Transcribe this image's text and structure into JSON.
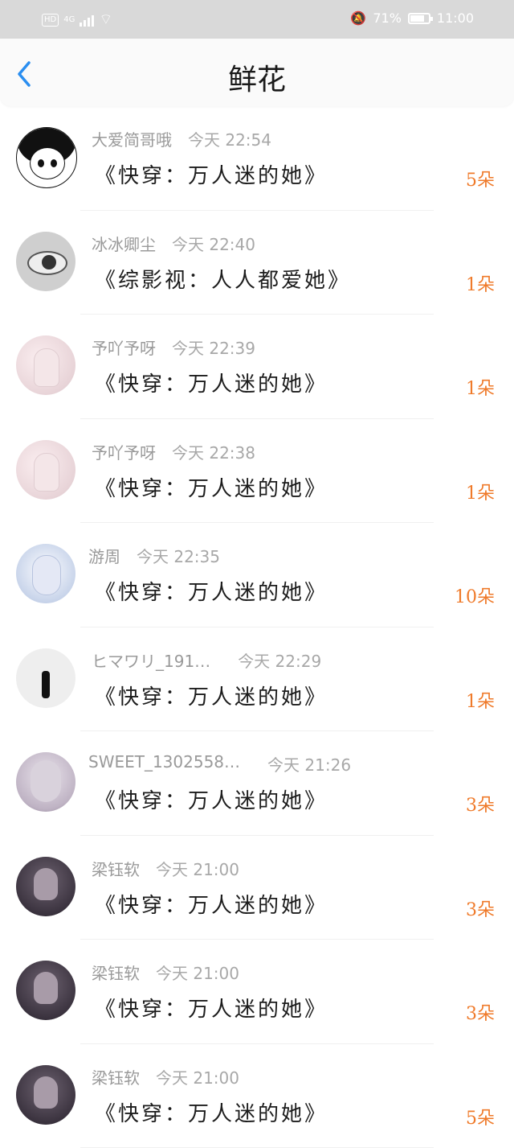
{
  "status_bar": {
    "network": "4G",
    "hd_label": "HD",
    "battery_percent": "71%",
    "time": "11:00"
  },
  "header": {
    "title": "鲜花",
    "back_icon": "chevron-left-icon"
  },
  "rows": [
    {
      "user": "大爱简哥哦",
      "time": "今天 22:54",
      "book": "《快穿：万人迷的她》",
      "flowers": "5朵"
    },
    {
      "user": "冰冰卿尘",
      "time": "今天 22:40",
      "book": "《综影视：人人都爱她》",
      "flowers": "1朵"
    },
    {
      "user": "予吖予呀",
      "time": "今天 22:39",
      "book": "《快穿：万人迷的她》",
      "flowers": "1朵"
    },
    {
      "user": "予吖予呀",
      "time": "今天 22:38",
      "book": "《快穿：万人迷的她》",
      "flowers": "1朵"
    },
    {
      "user": "游周",
      "time": "今天 22:35",
      "book": "《快穿：万人迷的她》",
      "flowers": "10朵"
    },
    {
      "user": "ヒマワリ_191…",
      "time": "今天 22:29",
      "book": "《快穿：万人迷的她》",
      "flowers": "1朵"
    },
    {
      "user": "SWEET_1302558…",
      "time": "今天 21:26",
      "book": "《快穿：万人迷的她》",
      "flowers": "3朵"
    },
    {
      "user": "梁钰软",
      "time": "今天 21:00",
      "book": "《快穿：万人迷的她》",
      "flowers": "3朵"
    },
    {
      "user": "梁钰软",
      "time": "今天 21:00",
      "book": "《快穿：万人迷的她》",
      "flowers": "3朵"
    },
    {
      "user": "梁钰软",
      "time": "今天 21:00",
      "book": "《快穿：万人迷的她》",
      "flowers": "5朵"
    }
  ],
  "colors": {
    "accent_blue": "#2a8ef0",
    "flower_orange": "#ef7a2a",
    "status_bar": "#d9d9d9"
  }
}
